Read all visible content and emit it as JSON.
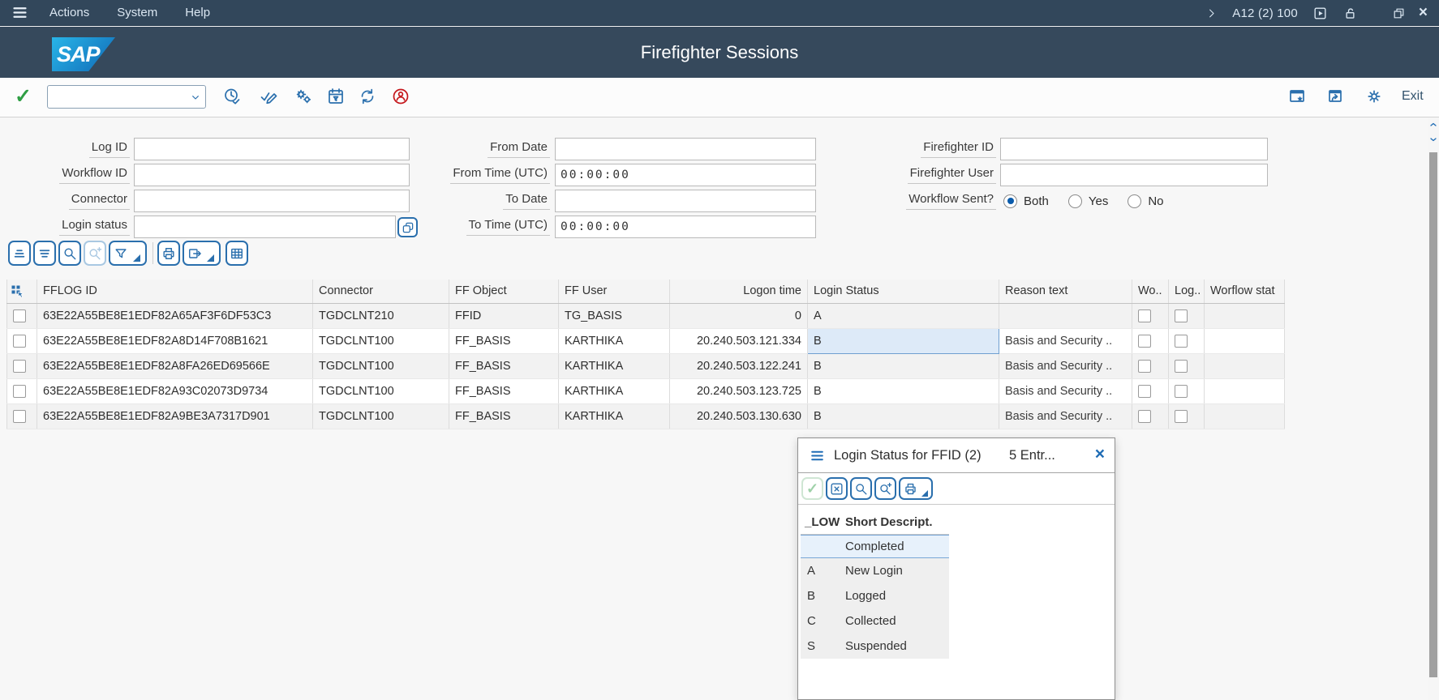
{
  "window": {
    "menus": [
      {
        "label": "Actions"
      },
      {
        "label": "System"
      },
      {
        "label": "Help"
      }
    ],
    "system_status": "A12 (2) 100",
    "title": "Firefighter Sessions",
    "logo_text": "SAP"
  },
  "toolbar": {
    "command_value": "",
    "exit_label": "Exit"
  },
  "filters": {
    "left": [
      {
        "label": "Log ID",
        "value": ""
      },
      {
        "label": "Workflow ID",
        "value": ""
      },
      {
        "label": "Connector",
        "value": ""
      },
      {
        "label": "Login status",
        "value": ""
      }
    ],
    "middle": [
      {
        "label": "From Date",
        "value": ""
      },
      {
        "label": "From Time (UTC)",
        "value": "00:00:00"
      },
      {
        "label": "To Date",
        "value": ""
      },
      {
        "label": "To Time (UTC)",
        "value": "00:00:00"
      }
    ],
    "right": [
      {
        "label": "Firefighter ID",
        "value": ""
      },
      {
        "label": "Firefighter User",
        "value": ""
      }
    ],
    "workflow_sent": {
      "label": "Workflow Sent?",
      "options": [
        {
          "label": "Both",
          "selected": true
        },
        {
          "label": "Yes",
          "selected": false
        },
        {
          "label": "No",
          "selected": false
        }
      ]
    }
  },
  "table": {
    "columns": [
      "FFLOG ID",
      "Connector",
      "FF Object",
      "FF User",
      "Logon time",
      "Login Status",
      "Reason text",
      "Wo..",
      "Log..",
      "Worflow stat"
    ],
    "rows": [
      {
        "fflog_id": "63E22A55BE8E1EDF82A65AF3F6DF53C3",
        "connector": "TGDCLNT210",
        "ff_object": "FFID",
        "ff_user": "TG_BASIS",
        "logon_time": "0",
        "login_status": "A",
        "reason": "",
        "status_selected": false,
        "wo_checked": false,
        "log_checked": false,
        "worflow_status": ""
      },
      {
        "fflog_id": "63E22A55BE8E1EDF82A8D14F708B1621",
        "connector": "TGDCLNT100",
        "ff_object": "FF_BASIS",
        "ff_user": "KARTHIKA",
        "logon_time": "20.240.503.121.334",
        "login_status": "B",
        "reason": "Basis and Security ..",
        "status_selected": true,
        "wo_checked": false,
        "log_checked": false,
        "worflow_status": ""
      },
      {
        "fflog_id": "63E22A55BE8E1EDF82A8FA26ED69566E",
        "connector": "TGDCLNT100",
        "ff_object": "FF_BASIS",
        "ff_user": "KARTHIKA",
        "logon_time": "20.240.503.122.241",
        "login_status": "B",
        "reason": "Basis and Security ..",
        "status_selected": false,
        "wo_checked": false,
        "log_checked": false,
        "worflow_status": ""
      },
      {
        "fflog_id": "63E22A55BE8E1EDF82A93C02073D9734",
        "connector": "TGDCLNT100",
        "ff_object": "FF_BASIS",
        "ff_user": "KARTHIKA",
        "logon_time": "20.240.503.123.725",
        "login_status": "B",
        "reason": "Basis and Security ..",
        "status_selected": false,
        "wo_checked": false,
        "log_checked": false,
        "worflow_status": ""
      },
      {
        "fflog_id": "63E22A55BE8E1EDF82A9BE3A7317D901",
        "connector": "TGDCLNT100",
        "ff_object": "FF_BASIS",
        "ff_user": "KARTHIKA",
        "logon_time": "20.240.503.130.630",
        "login_status": "B",
        "reason": "Basis and Security ..",
        "status_selected": false,
        "wo_checked": false,
        "log_checked": false,
        "worflow_status": ""
      }
    ]
  },
  "popup": {
    "title": "Login Status for FFID (2)",
    "entries_label": "5 Entr...",
    "columns": [
      "_LOW",
      "Short Descript."
    ],
    "rows": [
      {
        "key": "",
        "desc": "Completed",
        "selected": true
      },
      {
        "key": "A",
        "desc": "New Login",
        "selected": false
      },
      {
        "key": "B",
        "desc": "Logged",
        "selected": false
      },
      {
        "key": "C",
        "desc": "Collected",
        "selected": false
      },
      {
        "key": "S",
        "desc": "Suspended",
        "selected": false
      }
    ]
  },
  "colors": {
    "bar_bg": "#32475b",
    "header_bg": "#36495c",
    "icon_blue": "#2a6fad",
    "green": "#2f9e44",
    "red": "#c5171c",
    "selection": "#ddeaf8"
  }
}
